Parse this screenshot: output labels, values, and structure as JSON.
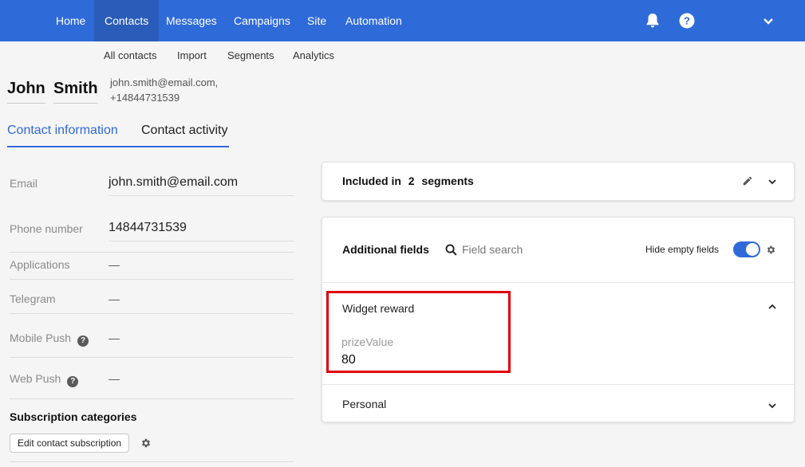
{
  "nav": {
    "items": [
      {
        "label": "Home",
        "active": false
      },
      {
        "label": "Contacts",
        "active": true
      },
      {
        "label": "Messages",
        "active": false
      },
      {
        "label": "Campaigns",
        "active": false
      },
      {
        "label": "Site",
        "active": false
      },
      {
        "label": "Automation",
        "active": false
      }
    ],
    "icons": [
      "bell-icon",
      "help-icon",
      "chevron-down-icon"
    ]
  },
  "subnav": {
    "items": [
      "All contacts",
      "Import",
      "Segments",
      "Analytics"
    ]
  },
  "contact": {
    "first_name": "John",
    "last_name": "Smith",
    "email_line": "john.smith@email.com,",
    "phone_line": "+14844731539"
  },
  "tabs": [
    "Contact information",
    "Contact activity"
  ],
  "fields": {
    "email": {
      "label": "Email",
      "value": "john.smith@email.com"
    },
    "phone": {
      "label": "Phone number",
      "value": "14844731539"
    },
    "applications": {
      "label": "Applications",
      "value": "—"
    },
    "telegram": {
      "label": "Telegram",
      "value": "—"
    },
    "mobile_push": {
      "label": "Mobile Push",
      "value": "—"
    },
    "web_push": {
      "label": "Web Push",
      "value": "—"
    }
  },
  "subscription": {
    "title": "Subscription categories",
    "button": "Edit contact subscription"
  },
  "segments_card": {
    "prefix": "Included in",
    "count": "2",
    "suffix": "segments"
  },
  "additional_fields": {
    "title": "Additional fields",
    "search_placeholder": "Field search",
    "hide_empty_label": "Hide empty fields",
    "hide_empty_on": true,
    "widget_section": "Widget reward",
    "prize_label": "prizeValue",
    "prize_value": "80",
    "personal_section": "Personal"
  },
  "colors": {
    "accent": "#2f6ad9",
    "nav_active": "#2a5cba",
    "highlight": "#e0000a"
  }
}
